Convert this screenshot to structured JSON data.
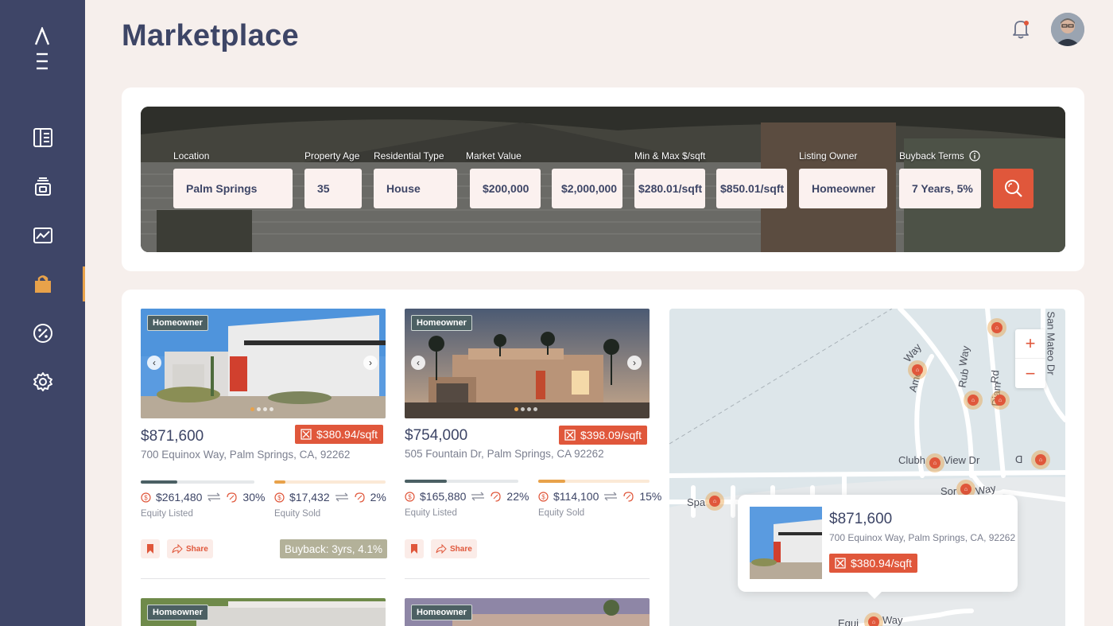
{
  "app": {
    "title": "Marketplace"
  },
  "nav": {
    "items": [
      {
        "name": "dashboard",
        "icon": "layout-icon"
      },
      {
        "name": "inventory",
        "icon": "box-stack-icon"
      },
      {
        "name": "analytics",
        "icon": "chart-icon"
      },
      {
        "name": "marketplace",
        "icon": "bag-icon",
        "active": true
      },
      {
        "name": "deals",
        "icon": "percent-badge-icon"
      },
      {
        "name": "settings",
        "icon": "gear-icon"
      }
    ]
  },
  "search": {
    "labels": {
      "location": "Location",
      "age": "Property Age",
      "type": "Residential Type",
      "market": "Market Value",
      "sqft": "Min & Max $/sqft",
      "owner": "Listing Owner",
      "buyback": "Buyback Terms"
    },
    "values": {
      "location": "Palm Springs",
      "age": "35",
      "type": "House",
      "market_min": "$200,000",
      "market_max": "$2,000,000",
      "sqft_min": "$280.01/sqft",
      "sqft_max": "$850.01/sqft",
      "owner": "Homeowner",
      "buyback": "7 Years, 5%"
    }
  },
  "listings": [
    {
      "tag": "Homeowner",
      "price": "$871,600",
      "ppsf": "$380.94/sqft",
      "address": "700 Equinox Way, Palm Springs, CA, 92262",
      "equity_listed": {
        "amount": "$261,480",
        "pct": "30%",
        "fill": 0.3,
        "label": "Equity Listed"
      },
      "equity_sold": {
        "amount": "$17,432",
        "pct": "2%",
        "fill": 0.1,
        "label": "Equity Sold"
      },
      "share": "Share",
      "buyback": "Buyback: 3yrs, 4.1%"
    },
    {
      "tag": "Homeowner",
      "price": "$754,000",
      "ppsf": "$398.09/sqft",
      "address": "505 Fountain Dr, Palm Springs, CA 92262",
      "equity_listed": {
        "amount": "$165,880",
        "pct": "22%",
        "fill": 0.37,
        "label": "Equity Listed"
      },
      "equity_sold": {
        "amount": "$114,100",
        "pct": "15%",
        "fill": 0.24,
        "label": "Equity Sold"
      },
      "share": "Share"
    },
    {
      "tag": "Homeowner"
    },
    {
      "tag": "Homeowner"
    }
  ],
  "map": {
    "streets": [
      "Way",
      "Amer",
      "Rub",
      "Way",
      "Diam",
      "Rd",
      "San Mateo Dr",
      "Clubh",
      "View Dr",
      "D",
      "Sor",
      "Way",
      "Spa",
      "Equi",
      "Way"
    ],
    "popup": {
      "price": "$871,600",
      "address": "700 Equinox Way, Palm Springs, CA, 92262",
      "ppsf": "$380.94/sqft"
    },
    "zoom_in": "+",
    "zoom_out": "−"
  },
  "colors": {
    "sidebar": "#3e4567",
    "accent": "#e0573b",
    "highlight": "#e8a24a",
    "ink": "#3d4566"
  }
}
